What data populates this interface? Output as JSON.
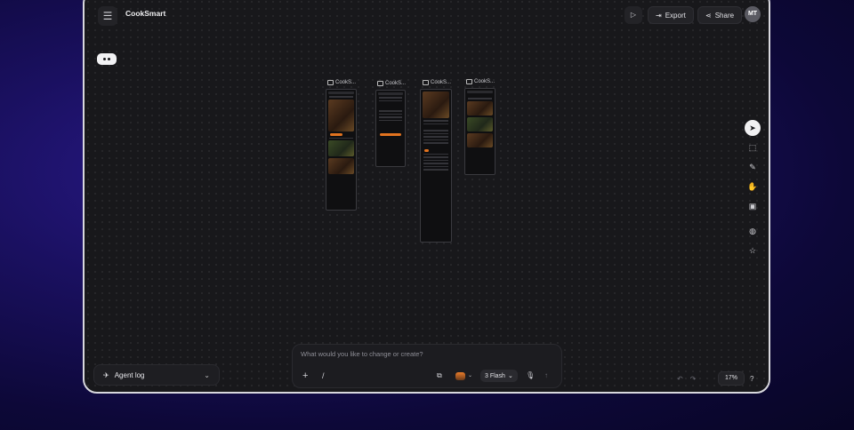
{
  "app": {
    "title": "CookSmart"
  },
  "header": {
    "export_label": "Export",
    "share_label": "Share",
    "avatar_initials": "MT"
  },
  "canvas": {
    "frames": [
      {
        "label": "CookS..."
      },
      {
        "label": "CookS..."
      },
      {
        "label": "CookS..."
      },
      {
        "label": "CookS..."
      }
    ]
  },
  "tools": [
    {
      "icon": "cursor-icon",
      "active": true
    },
    {
      "icon": "marquee-select-icon"
    },
    {
      "icon": "pencil-icon"
    },
    {
      "icon": "hand-icon"
    },
    {
      "icon": "image-icon"
    },
    {
      "icon": "palette-icon"
    },
    {
      "icon": "star-icon"
    }
  ],
  "agent_log": {
    "label": "Agent log"
  },
  "prompt": {
    "placeholder": "What would you like to change or create?",
    "model_label": "3 Flash"
  },
  "zoom": {
    "value": "17%"
  },
  "help": {
    "label": "?"
  }
}
